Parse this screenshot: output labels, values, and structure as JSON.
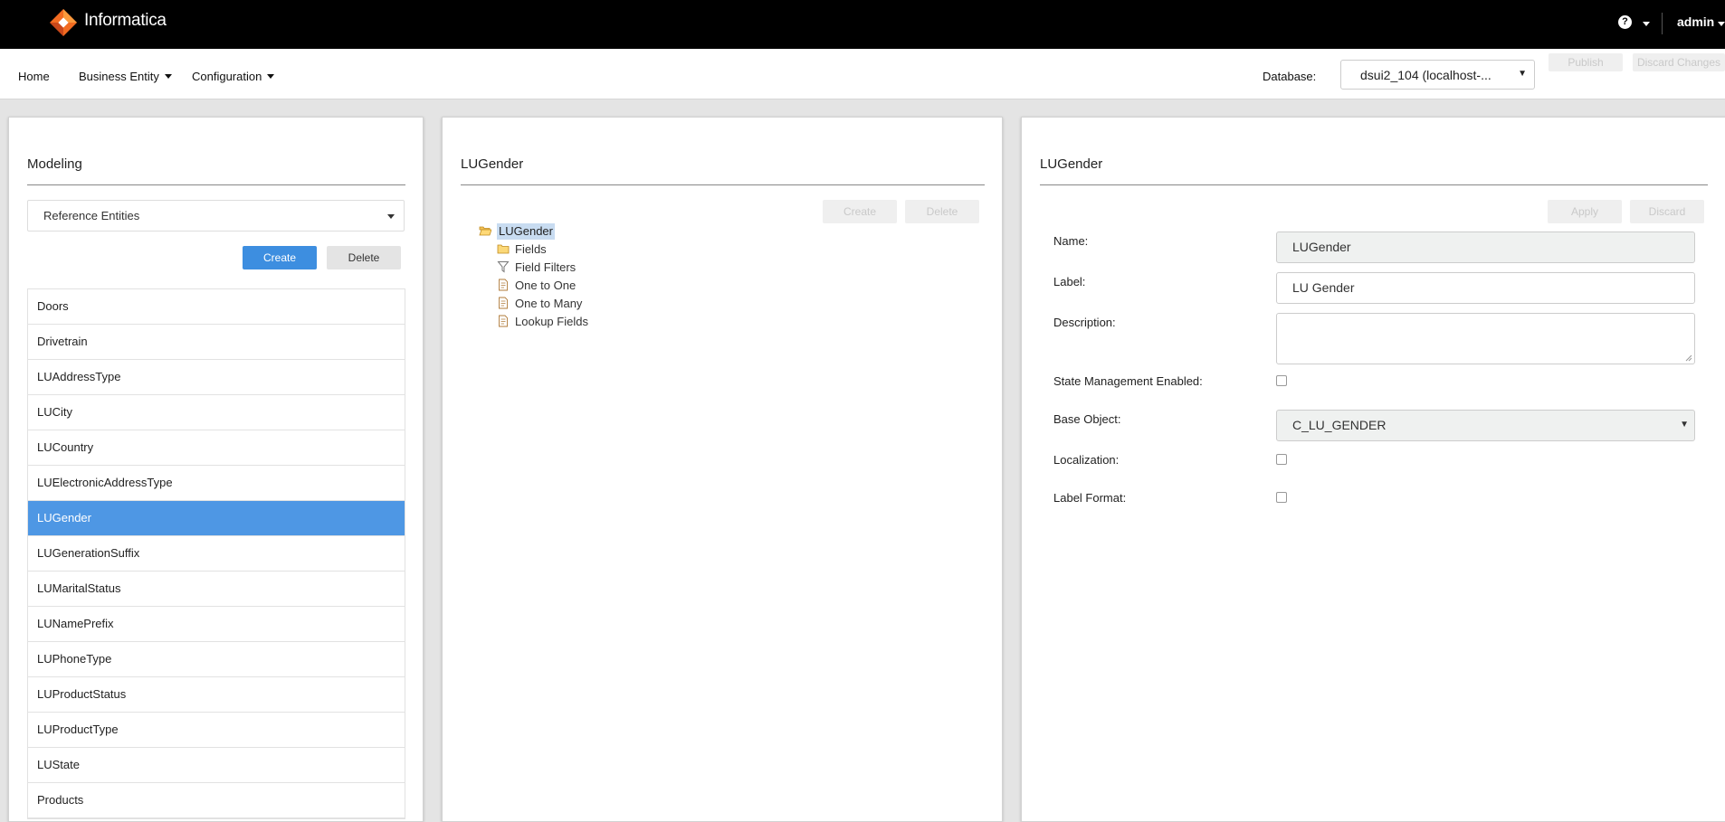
{
  "app": {
    "brand": "Informatica",
    "help_icon": "?",
    "user": "admin"
  },
  "nav": {
    "home": "Home",
    "business_entity": "Business Entity",
    "configuration": "Configuration",
    "database_label": "Database:",
    "database_value": "dsui2_104 (localhost-...",
    "publish": "Publish",
    "discard_changes": "Discard Changes"
  },
  "modeling": {
    "title": "Modeling",
    "entity_type": "Reference Entities",
    "create": "Create",
    "delete": "Delete",
    "entities": [
      "Doors",
      "Drivetrain",
      "LUAddressType",
      "LUCity",
      "LUCountry",
      "LUElectronicAddressType",
      "LUGender",
      "LUGenerationSuffix",
      "LUMaritalStatus",
      "LUNamePrefix",
      "LUPhoneType",
      "LUProductStatus",
      "LUProductType",
      "LUState",
      "Products"
    ],
    "selected": "LUGender"
  },
  "tree_panel": {
    "title": "LUGender",
    "create": "Create",
    "delete": "Delete",
    "root": "LUGender",
    "children": [
      "Fields",
      "Field Filters",
      "One to One",
      "One to Many",
      "Lookup Fields"
    ]
  },
  "detail": {
    "title": "LUGender",
    "apply": "Apply",
    "discard": "Discard",
    "name_label": "Name:",
    "name_value": "LUGender",
    "label_label": "Label:",
    "label_value": "LU Gender",
    "description_label": "Description:",
    "description_value": "",
    "state_label": "State Management Enabled:",
    "base_object_label": "Base Object:",
    "base_object_value": "C_LU_GENDER",
    "localization_label": "Localization:",
    "label_format_label": "Label Format:",
    "state_checked": false,
    "localization_checked": false,
    "label_format_checked": false
  },
  "colors": {
    "accent": "#3d8ee0",
    "selected_row": "#4e97e4",
    "topbar": "#000000",
    "logo_orange": "#f26b21"
  }
}
